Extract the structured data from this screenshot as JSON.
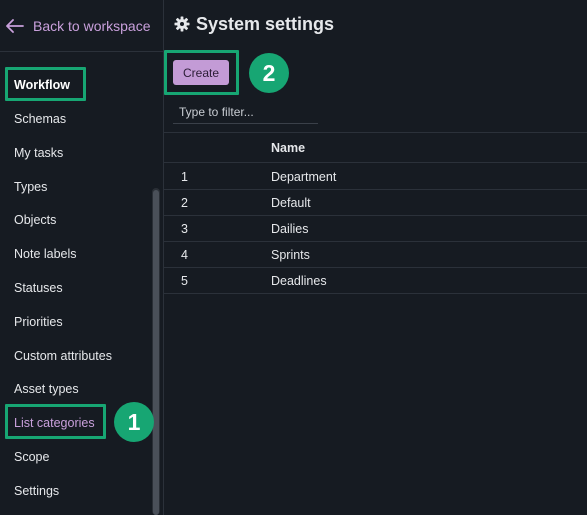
{
  "sidebar": {
    "back_label": "Back to workspace",
    "heading": "Workflow",
    "items": [
      "Schemas",
      "My tasks",
      "Types",
      "Objects",
      "Note labels",
      "Statuses",
      "Priorities",
      "Custom attributes",
      "Asset types",
      "List categories",
      "Scope",
      "Settings"
    ],
    "active_item": "List categories"
  },
  "header": {
    "title": "System settings",
    "icon": "gear-icon"
  },
  "toolbar": {
    "create_label": "Create"
  },
  "filter": {
    "placeholder": "Type to filter...",
    "value": ""
  },
  "table": {
    "columns": [
      "",
      "Name"
    ],
    "rows": [
      {
        "index": "1",
        "name": "Department"
      },
      {
        "index": "2",
        "name": "Default"
      },
      {
        "index": "3",
        "name": "Dailies"
      },
      {
        "index": "4",
        "name": "Sprints"
      },
      {
        "index": "5",
        "name": "Deadlines"
      }
    ]
  },
  "annotations": {
    "step1": "1",
    "step2": "2"
  },
  "colors": {
    "background": "#161b22",
    "accent": "#c9a0dc",
    "highlight": "#17a673"
  }
}
